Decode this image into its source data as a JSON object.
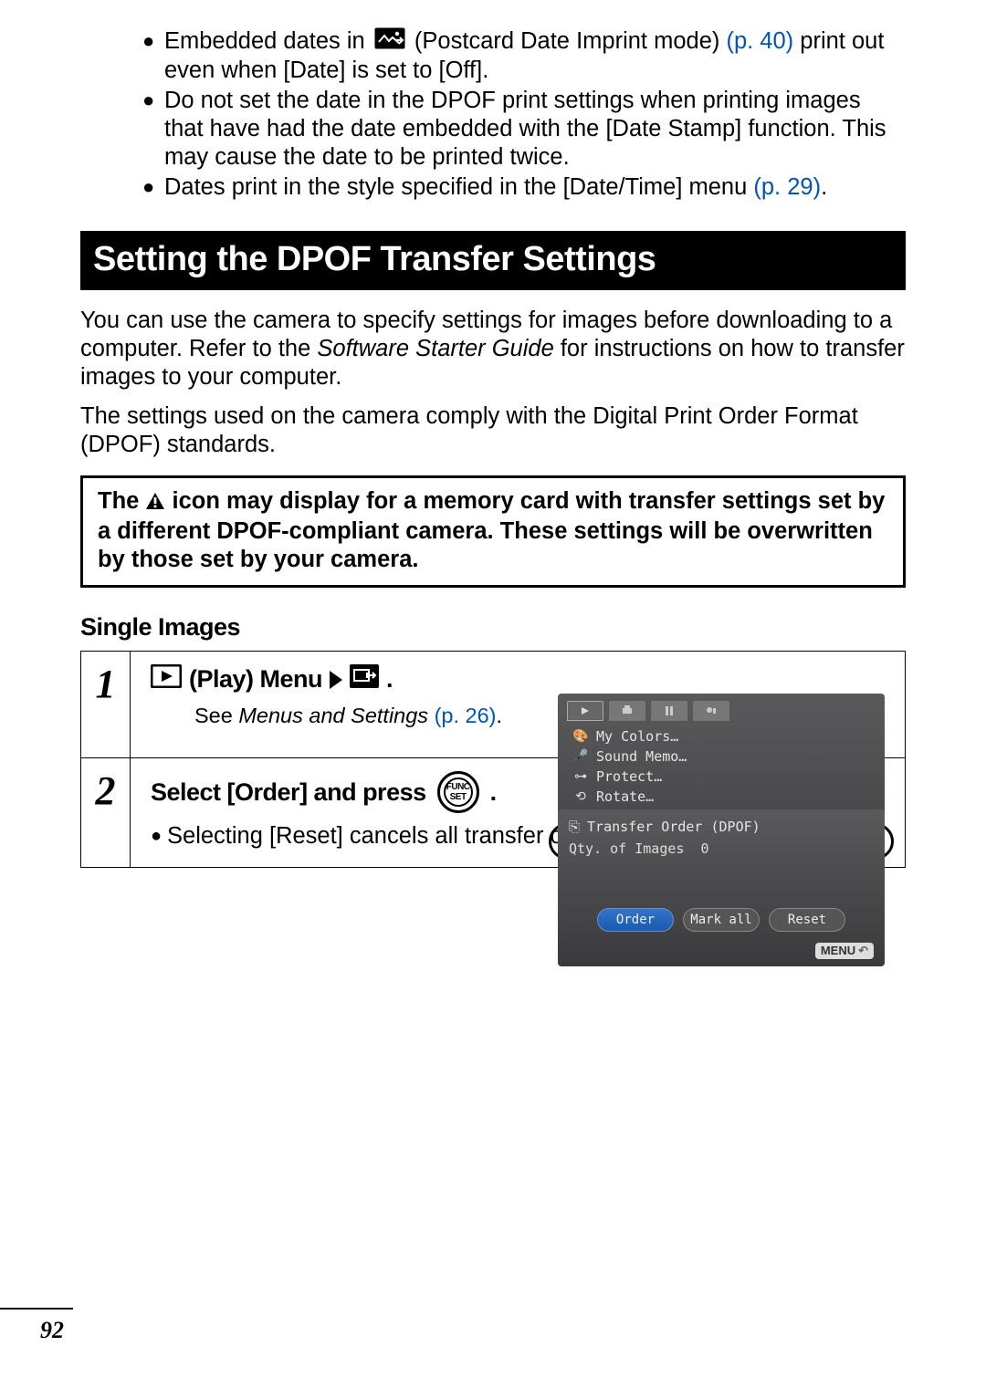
{
  "page_number": "92",
  "bullets": {
    "b1_part1": "Embedded dates in ",
    "b1_part2": " (Postcard Date Imprint mode) ",
    "b1_ref": "(p. 40)",
    "b1_part3": " print out even when [Date] is set to [Off].",
    "b2": "Do not set the date in the DPOF print settings when printing images that have had the date embedded with the [Date Stamp] function. This may cause the date to be printed twice.",
    "b3_part1": "Dates print in the style specified in the [Date/Time] menu ",
    "b3_ref": "(p. 29)",
    "b3_part2": "."
  },
  "section_title": "Setting the DPOF Transfer Settings",
  "body": {
    "p1": "You can use the camera to specify settings for images before downloading to a computer. Refer to the Software Starter Guide for instructions on how to transfer images to your computer.",
    "p2": "The settings used on the camera comply with the Digital Print Order Format (DPOF) standards."
  },
  "warning": {
    "part1": "The ",
    "part2": " icon may display for a memory card with transfer settings set by a different DPOF-compliant camera. These settings will be overwritten by those set by your camera."
  },
  "subheading": "Single Images",
  "steps": {
    "s1": {
      "num": "1",
      "head_text": " (Play) Menu",
      "see_prefix": "See ",
      "see_italic": "Menus and Settings ",
      "see_ref": "(p. 26)",
      "see_suffix": ".",
      "menu": {
        "items": [
          "My Colors…",
          "Sound Memo…",
          "Protect…",
          "Rotate…"
        ],
        "selected": "Transfer Order…"
      }
    },
    "s2": {
      "num": "2",
      "head_text": "Select [Order] and press ",
      "head_suffix": ".",
      "bullet": "Selecting [Reset] cancels all transfer order settings.",
      "screen": {
        "title": "Transfer Order (DPOF)",
        "qty_label": "Qty. of Images",
        "qty_value": "0",
        "buttons": [
          "Order",
          "Mark all",
          "Reset"
        ],
        "menu_label": "MENU"
      }
    }
  },
  "func_btn": {
    "line1": "FUNC",
    "line2": "SET"
  }
}
